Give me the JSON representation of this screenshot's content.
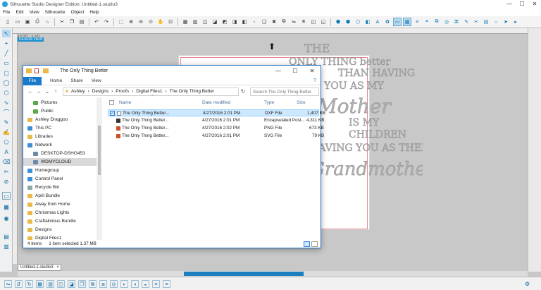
{
  "app": {
    "title": "Silhouette Studio Designer Edition: Untitled-1.studio3",
    "minimize": "—",
    "maximize": "☐",
    "close": "✕"
  },
  "menu": [
    "File",
    "Edit",
    "View",
    "Silhouette",
    "Object",
    "Help"
  ],
  "workspace": {
    "coords": "10.021 , 1.141",
    "selection_label": "DESIGN VIEW",
    "doc_tab": "Untitled-1.studio3",
    "doc_tab_close": "×"
  },
  "artwork": {
    "lines": [
      "THE",
      "ONLY THING better",
      "THAN HAVING",
      "YOU AS MY",
      "Mother",
      "IS MY",
      "CHILDREN",
      "HAVING YOU AS THEIR",
      "Grandmother"
    ]
  },
  "explorer": {
    "title": "The Only Thing Better",
    "minimize": "—",
    "maximize": "☐",
    "close": "✕",
    "ribbon": {
      "file": "File",
      "tabs": [
        "Home",
        "Share",
        "View"
      ]
    },
    "breadcrumb": [
      "Ashley",
      "Designs",
      "Proofs",
      "Digital Files1",
      "The Only Thing Better"
    ],
    "search_placeholder": "Search The Only Thing Better",
    "nav_items": [
      "Pictures",
      "Public",
      "Ashley Draggoo",
      "This PC",
      "Libraries",
      "Network",
      "DESKTOP-DSHG453",
      "WDMYCLOUD",
      "Homegroup",
      "Control Panel",
      "Recycle Bin",
      "April Bundle",
      "Away from Home",
      "Christmas Lights",
      "Craftalicious Bundle",
      "Designs",
      "Digital Files1"
    ],
    "columns": {
      "name": "Name",
      "date": "Date modified",
      "type": "Type",
      "size": "Size"
    },
    "files": [
      {
        "name": "The Only Thing Better...",
        "date": "4/27/2016 2:01 PM",
        "type": "DXF File",
        "size": "1,407 KB"
      },
      {
        "name": "The Only Thing Better...",
        "date": "4/27/2016 2:01 PM",
        "type": "Encapsulated Post...",
        "size": "4,311 KB"
      },
      {
        "name": "The Only Thing Better...",
        "date": "4/27/2016 2:02 PM",
        "type": "PNG File",
        "size": "673 KB"
      },
      {
        "name": "The Only Thing Better...",
        "date": "4/27/2016 2:01 PM",
        "type": "SVG File",
        "size": "79 KB"
      }
    ],
    "status": {
      "items": "4 items",
      "selected": "1 item selected  1.37 MB"
    }
  },
  "colors": {
    "accent": "#1979ca",
    "cutline": "#e8888f",
    "selection": "#cce8ff"
  }
}
